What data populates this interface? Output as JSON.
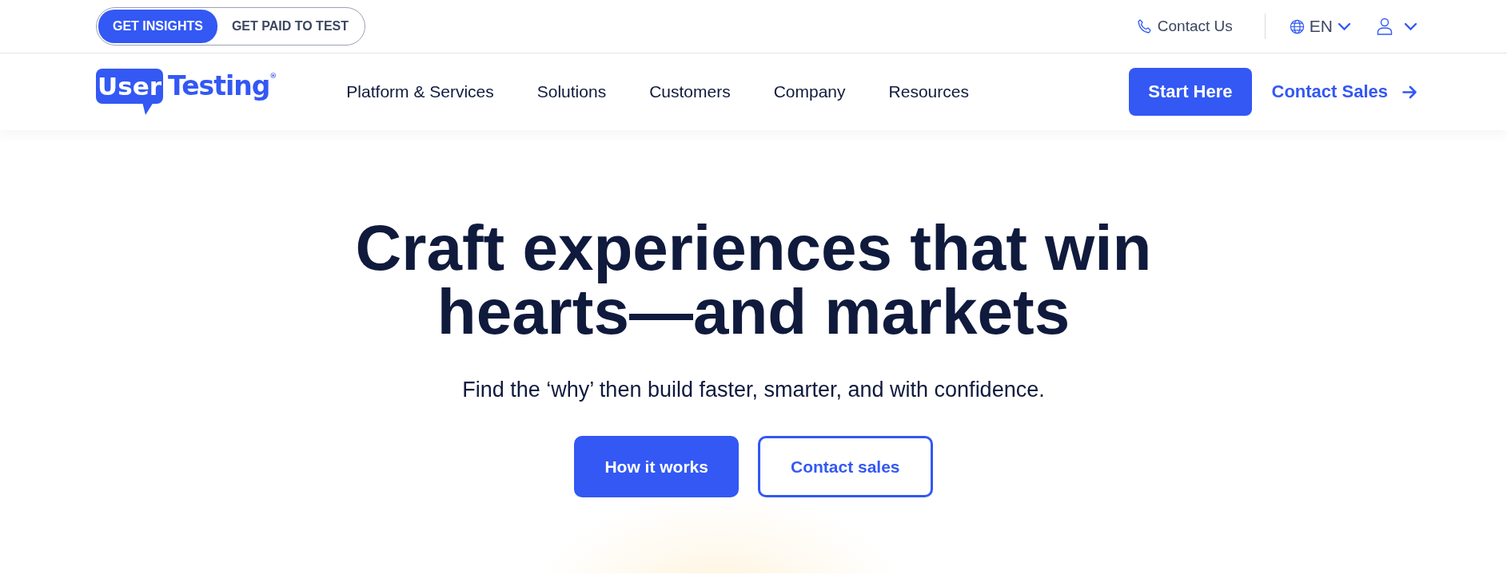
{
  "audience_toggle": [
    {
      "label": "GET INSIGHTS",
      "selected": true
    },
    {
      "label": "GET PAID TO TEST",
      "selected": false
    }
  ],
  "utility_links": {
    "contact": "Contact Us",
    "language": "EN"
  },
  "logo": {
    "badge": "User",
    "text": "Testing$^{®}$"
  },
  "nav": [
    "Platform & Services",
    "Solutions",
    "Customers",
    "Company",
    "Resources"
  ],
  "nav_actions": {
    "primary": "Start Here",
    "secondary": "Contact Sales"
  },
  "hero": {
    "heading": "Craft experiences that win hearts—and markets",
    "subheading": "Find the ‘why’ then build faster, smarter, and with confidence.",
    "buttons": [
      {
        "label": "How it works",
        "kind": "primary"
      },
      {
        "label": "Contact sales",
        "kind": "outline"
      }
    ]
  }
}
